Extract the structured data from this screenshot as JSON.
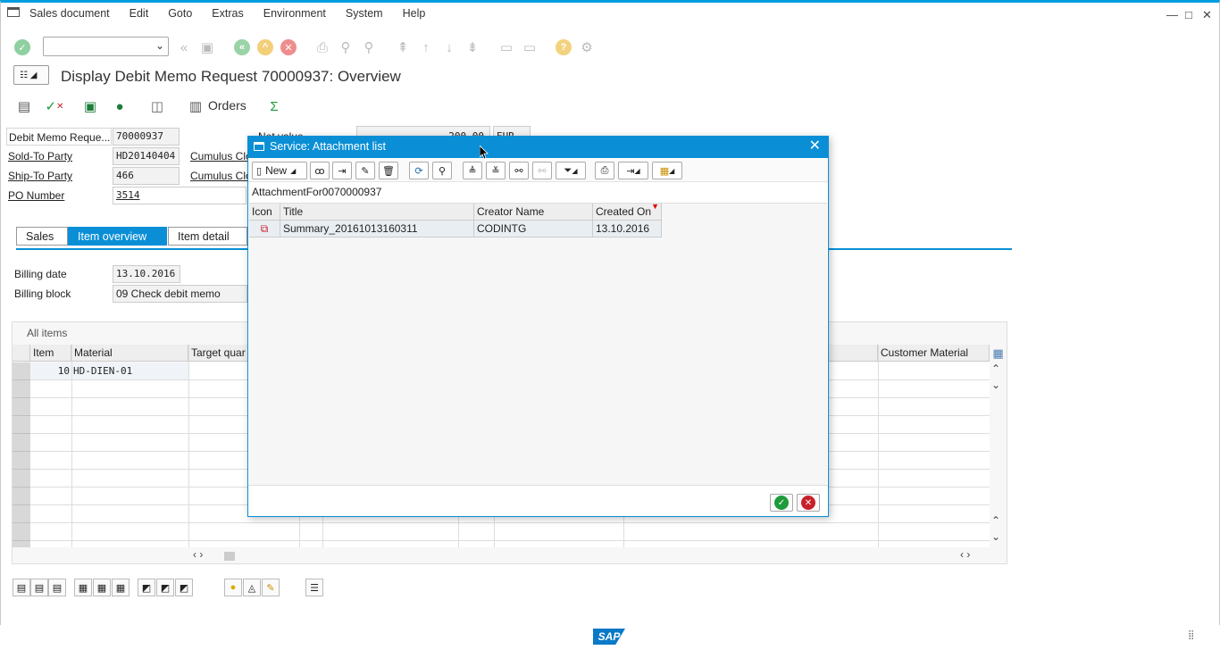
{
  "menu": {
    "items": [
      "Sales document",
      "Edit",
      "Goto",
      "Extras",
      "Environment",
      "System",
      "Help"
    ]
  },
  "window_controls": [
    "—",
    "□",
    "✕"
  ],
  "title": "Display Debit Memo Request 70000937: Overview",
  "app_toolbar": {
    "orders_label": "Orders",
    "sum_symbol": "Σ"
  },
  "header": {
    "debit_memo_label": "Debit Memo Reque...",
    "debit_memo_value": "70000937",
    "sold_to_label": "Sold-To Party",
    "sold_to_value": "HD20140404",
    "sold_to_name": "Cumulus Clo",
    "ship_to_label": "Ship-To Party",
    "ship_to_value": "466",
    "ship_to_name": "Cumulus Clo",
    "po_label": "PO Number",
    "po_value": "3514",
    "net_value_label": "Net value",
    "net_value": "200,00",
    "currency": "EUR"
  },
  "tabs": [
    "Sales",
    "Item overview",
    "Item detail"
  ],
  "item_overview": {
    "billing_date_label": "Billing date",
    "billing_date": "13.10.2016",
    "billing_block_label": "Billing block",
    "billing_block": "09 Check debit memo"
  },
  "items_table": {
    "caption": "All items",
    "columns": [
      "Item",
      "Material",
      "Target quar",
      "Customer Material"
    ],
    "rows": [
      {
        "item": "10",
        "material": "HD-DIEN-01"
      }
    ]
  },
  "dialog": {
    "title": "Service: Attachment list",
    "new_label": "New",
    "caption": "AttachmentFor0070000937",
    "columns": [
      "Icon",
      "Title",
      "Creator Name",
      "Created On"
    ],
    "rows": [
      {
        "title": "Summary_20161013160311",
        "creator": "CODINTG",
        "created_on": "13.10.2016"
      }
    ]
  },
  "status": {
    "logo": "SAP"
  },
  "colors": {
    "accent": "#0a8fd6",
    "ok": "#1e9b3a",
    "cancel": "#c8202a"
  }
}
